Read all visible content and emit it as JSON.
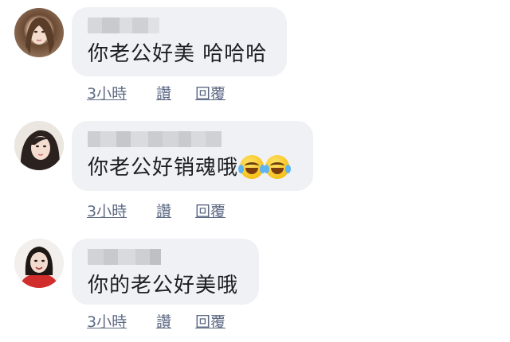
{
  "comments": [
    {
      "text": "你老公好美 哈哈哈",
      "emoji": [],
      "time": "3小時",
      "like_label": "讚",
      "reply_label": "回覆",
      "avatar": "avatar-woman-long-hair"
    },
    {
      "text": "你老公好销魂哦",
      "emoji": [
        "tears-of-joy-emoji",
        "tears-of-joy-emoji"
      ],
      "time": "3小時",
      "like_label": "讚",
      "reply_label": "回覆",
      "avatar": "avatar-woman-dark-hair"
    },
    {
      "text": "你的老公好美哦",
      "emoji": [],
      "time": "3小時",
      "like_label": "讚",
      "reply_label": "回覆",
      "avatar": "avatar-woman-red-top"
    }
  ],
  "colors": {
    "bubble": "#f0f1f4",
    "text": "#1c1e21",
    "action": "#5f6b85"
  }
}
